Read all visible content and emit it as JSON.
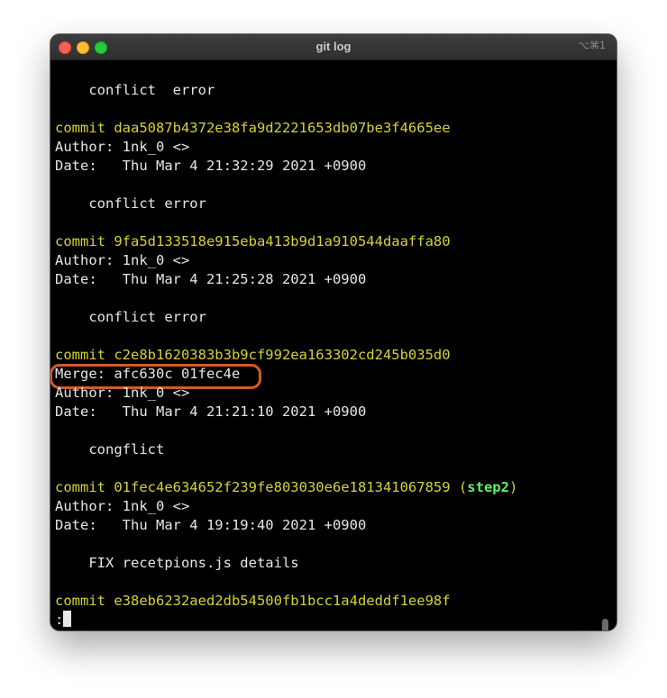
{
  "window": {
    "title": "git log",
    "shortcut": "⌥⌘1"
  },
  "log": {
    "l0_msg": "    conflict  error",
    "c1_commit": "commit daa5087b4372e38fa9d2221653db07be3f4665ee",
    "c1_author": "Author: 1nk_0 <>",
    "c1_date": "Date:   Thu Mar 4 21:32:29 2021 +0900",
    "c1_msg": "    conflict error",
    "c2_commit": "commit 9fa5d133518e915eba413b9d1a910544daaffa80",
    "c2_author": "Author: 1nk_0 <>",
    "c2_date": "Date:   Thu Mar 4 21:25:28 2021 +0900",
    "c2_msg": "    conflict error",
    "c3_commit": "commit c2e8b1620383b3b9cf992ea163302cd245b035d0",
    "c3_merge": "Merge: afc630c 01fec4e",
    "c3_author": "Author: 1nk_0 <>",
    "c3_date": "Date:   Thu Mar 4 21:21:10 2021 +0900",
    "c3_msg": "    congflict",
    "c4_commit": "commit 01fec4e634652f239fe803030e6e181341067859",
    "c4_ref_open": " (",
    "c4_ref": "step2",
    "c4_ref_close": ")",
    "c4_author": "Author: 1nk_0 <>",
    "c4_date": "Date:   Thu Mar 4 19:19:40 2021 +0900",
    "c4_msg": "    FIX recetpions.js details",
    "c5_commit": "commit e38eb6232aed2db54500fb1bcc1a4deddf1ee98f",
    "prompt": ":"
  },
  "colors": {
    "commit_hash": "#d5d236",
    "branch_ref": "#5ef16a",
    "highlight": "#d35a2b"
  }
}
